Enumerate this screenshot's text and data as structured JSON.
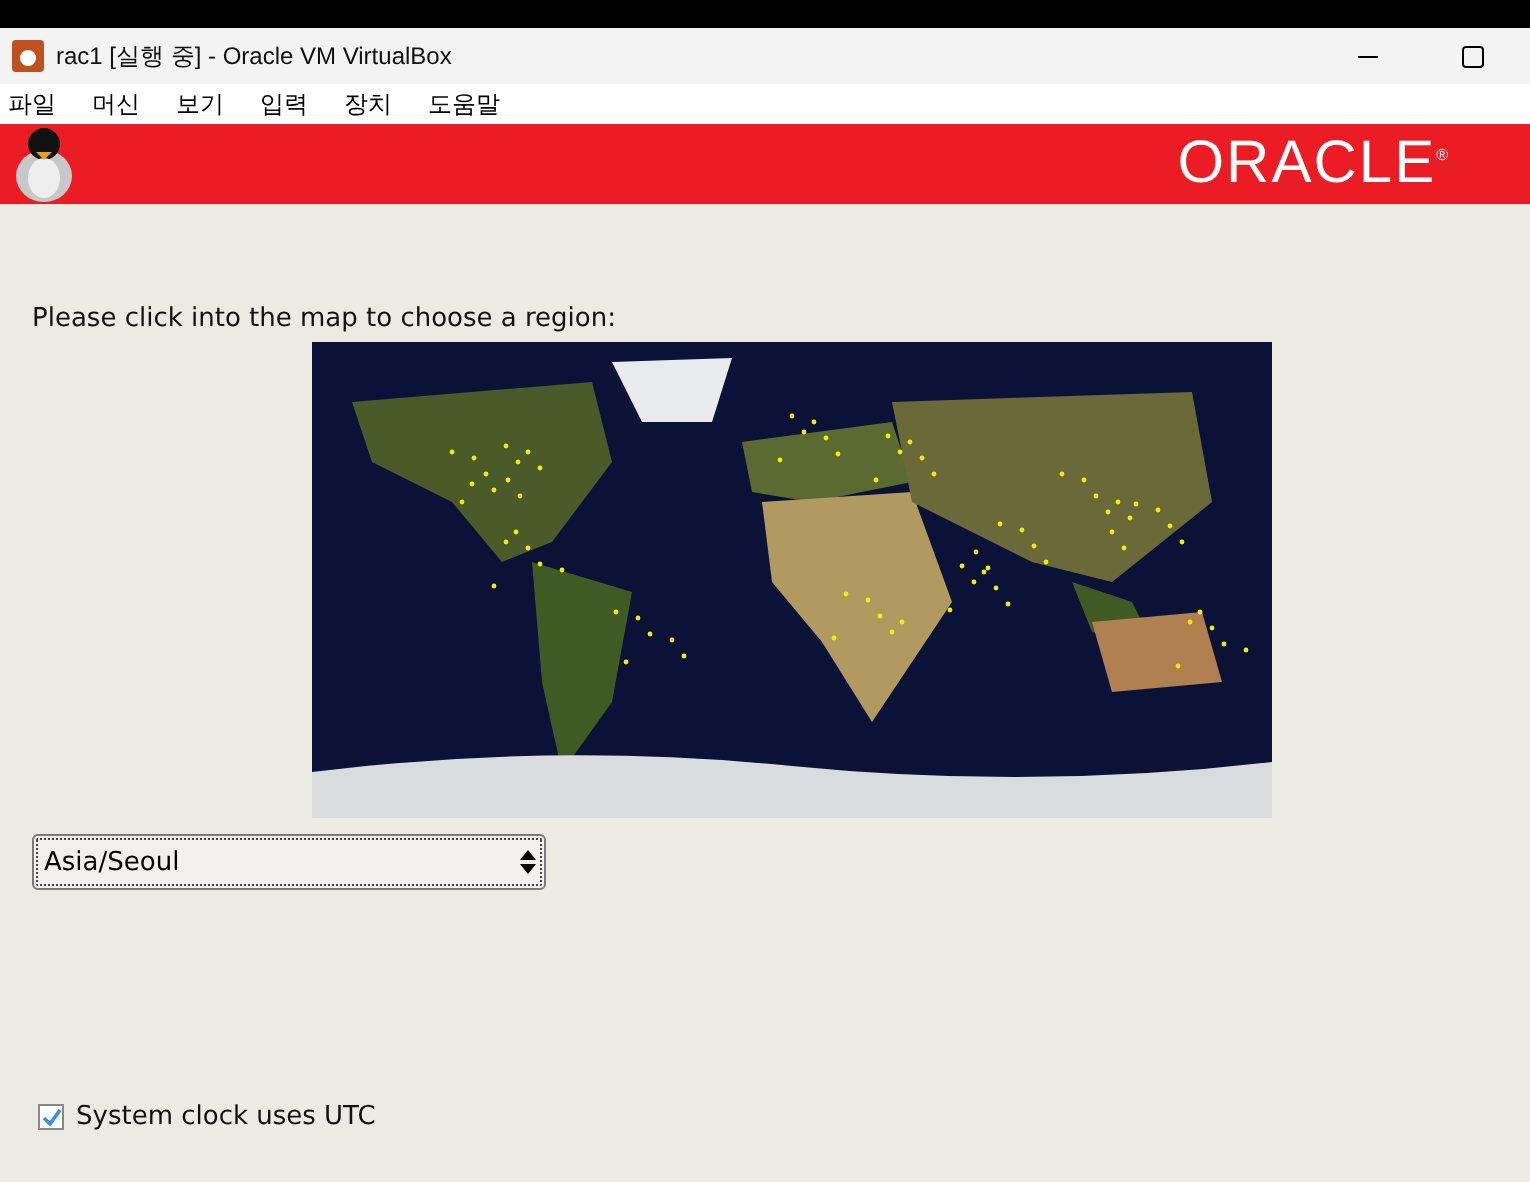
{
  "window": {
    "title": "rac1 [실행 중] - Oracle VM VirtualBox"
  },
  "menu": [
    "파일",
    "머신",
    "보기",
    "입력",
    "장치",
    "도움말"
  ],
  "banner": {
    "logo": "ORACLE",
    "mark": "®"
  },
  "prompt": "Please click into the map to choose a region:",
  "timezone": {
    "value": "Asia/Seoul"
  },
  "utc": {
    "label": "System clock uses UTC",
    "checked": true
  }
}
